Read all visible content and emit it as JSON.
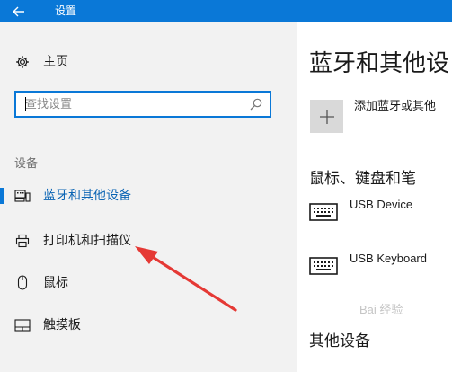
{
  "window": {
    "title": "设置"
  },
  "sidebar": {
    "home_label": "主页",
    "search": {
      "placeholder": "查找设置"
    },
    "section_label": "设备",
    "items": [
      {
        "label": "蓝牙和其他设备",
        "icon": "bluetooth-devices-icon",
        "selected": true
      },
      {
        "label": "打印机和扫描仪",
        "icon": "printer-icon",
        "selected": false
      },
      {
        "label": "鼠标",
        "icon": "mouse-icon",
        "selected": false
      },
      {
        "label": "触摸板",
        "icon": "touchpad-icon",
        "selected": false
      }
    ]
  },
  "main": {
    "title": "蓝牙和其他设",
    "add_label": "添加蓝牙或其他",
    "section_title": "鼠标、键盘和笔",
    "devices": [
      {
        "name": "USB Device",
        "icon": "keyboard-icon"
      },
      {
        "name": "USB Keyboard",
        "icon": "keyboard-icon"
      }
    ],
    "other_title": "其他设备"
  },
  "watermark": "Bai 经验",
  "colors": {
    "accent": "#0a78d7",
    "sidebar_bg": "#f2f2f2",
    "annotation_arrow": "#e53935"
  }
}
